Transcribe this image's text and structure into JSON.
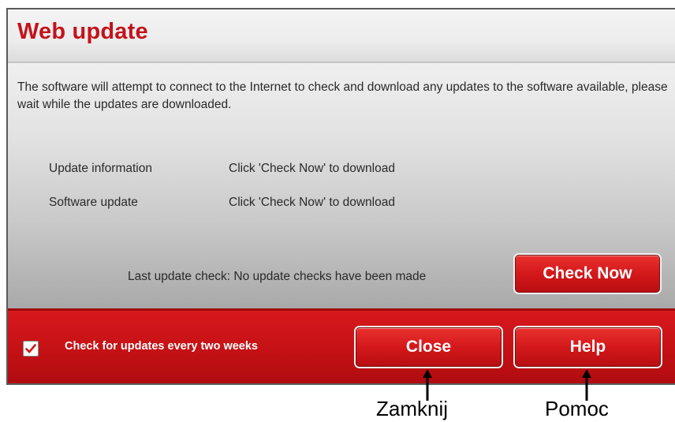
{
  "dialog": {
    "title": "Web update",
    "description": "The software will attempt to connect to the Internet to check and download any updates to the software available, please wait while the updates are downloaded.",
    "rows": [
      {
        "label": "Update information",
        "value": "Click 'Check Now' to download"
      },
      {
        "label": "Software update",
        "value": "Click 'Check Now' to download"
      }
    ],
    "last_check": "Last update check: No update checks have been made",
    "check_now_label": "Check Now",
    "auto_check": {
      "label": "Check for updates every two weeks",
      "checked": true
    },
    "close_label": "Close",
    "help_label": "Help",
    "accent_color": "#c4121a"
  },
  "annotations": {
    "close": "Zamknij",
    "help": "Pomoc"
  }
}
